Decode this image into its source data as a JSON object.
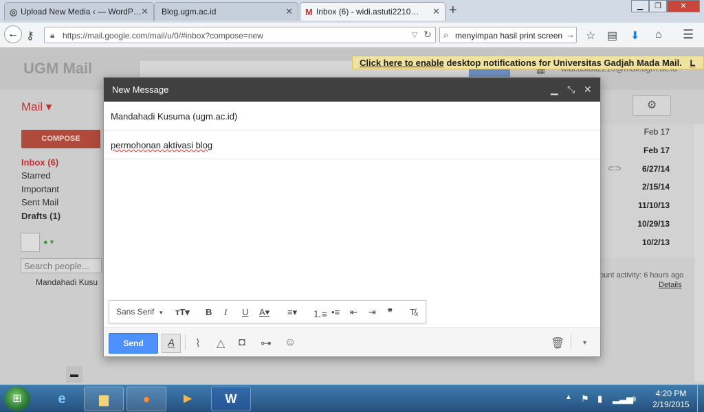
{
  "browser": {
    "tabs": [
      {
        "label": "Upload New Media ‹ — WordP…",
        "favicon": "wordpress-icon",
        "active": false
      },
      {
        "label": "Blog.ugm.ac.id",
        "favicon": "",
        "active": false
      },
      {
        "label": "Inbox (6) - widi.astuti2210…",
        "favicon": "gmail-icon",
        "active": true
      }
    ],
    "new_tab": "+",
    "url": "https://mail.google.com/mail/u/0/#inbox?compose=new",
    "search_query": "menyimpan hasil print screen"
  },
  "gmail": {
    "logo": "UGM Mail",
    "notification_link": "Click here to enable",
    "notification_text": " desktop notifications for Universitas Gadjah Mada Mail.",
    "notification_tail": "L",
    "account": "widi.astuti2210@mail.ugm.ac.id",
    "mail_label": "Mail ▾",
    "compose_label": "COMPOSE",
    "sidebar": [
      {
        "label": "Inbox (6)",
        "style": "red"
      },
      {
        "label": "Starred",
        "style": "normal"
      },
      {
        "label": "Important",
        "style": "normal"
      },
      {
        "label": "Sent Mail",
        "style": "normal"
      },
      {
        "label": "Drafts (1)",
        "style": "bold"
      }
    ],
    "search_people_placeholder": "Search people...",
    "contact": "Mandahadi Kusu",
    "dates": [
      "Feb 17",
      "Feb 17",
      "6/27/14",
      "2/15/14",
      "11/10/13",
      "10/29/13",
      "10/2/13"
    ],
    "activity": "ount activity: 6 hours ago",
    "details": "Details"
  },
  "compose": {
    "title": "New Message",
    "to": "Mandahadi Kusuma (ugm.ac.id)",
    "subject": "permohonan aktivasi blog",
    "font_name": "Sans Serif",
    "send_label": "Send"
  },
  "taskbar": {
    "time": "4:20 PM",
    "date": "2/19/2015"
  },
  "colors": {
    "send_blue": "#4d90fe",
    "compose_header": "#404040",
    "inbox_red": "#b33333",
    "notification_yellow": "#f0e3a0"
  }
}
